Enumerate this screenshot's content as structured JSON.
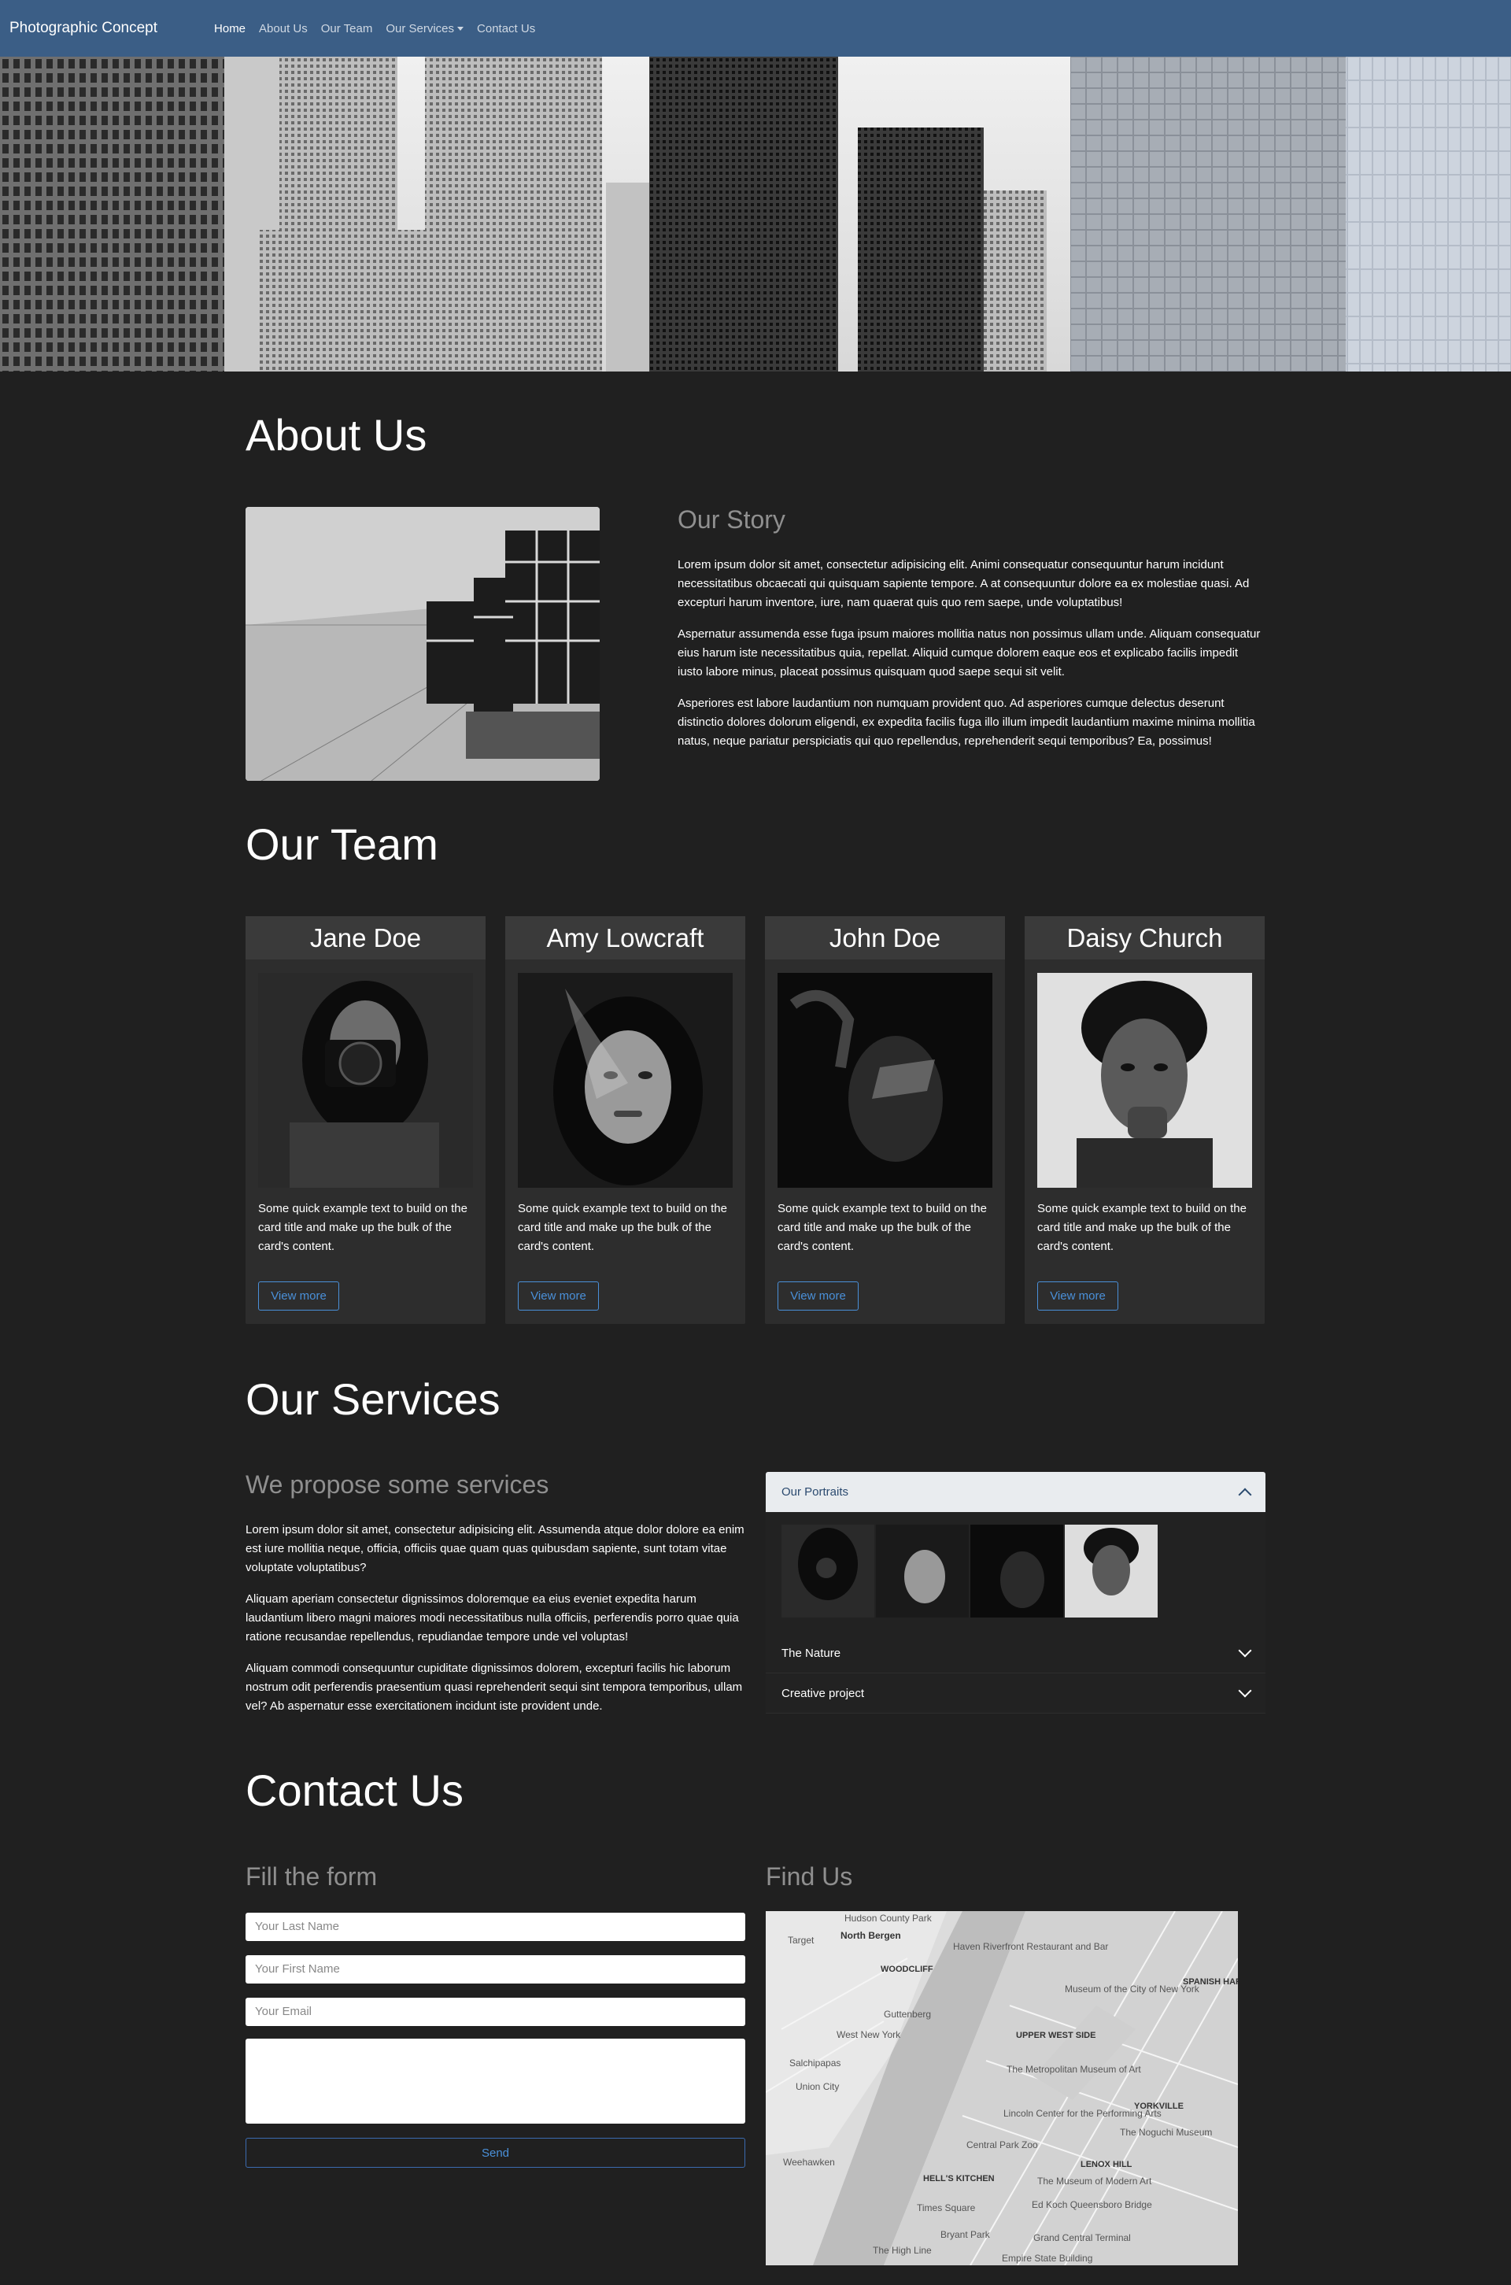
{
  "nav": {
    "brand": "Photographic Concept",
    "links": [
      "Home",
      "About Us",
      "Our Team",
      "Our Services",
      "Contact Us"
    ]
  },
  "about": {
    "title": "About Us",
    "subtitle": "Our Story",
    "paragraphs": [
      "Lorem ipsum dolor sit amet, consectetur adipisicing elit. Animi consequatur consequuntur harum incidunt necessitatibus obcaecati qui quisquam sapiente tempore. A at consequuntur dolore ea ex molestiae quasi. Ad excepturi harum inventore, iure, nam quaerat quis quo rem saepe, unde voluptatibus!",
      "Aspernatur assumenda esse fuga ipsum maiores mollitia natus non possimus ullam unde. Aliquam consequatur eius harum iste necessitatibus quia, repellat. Aliquid cumque dolorem eaque eos et explicabo facilis impedit iusto labore minus, placeat possimus quisquam quod saepe sequi sit velit.",
      "Asperiores est labore laudantium non numquam provident quo. Ad asperiores cumque delectus deserunt distinctio dolores dolorum eligendi, ex expedita facilis fuga illo illum impedit laudantium maxime minima mollitia natus, neque pariatur perspiciatis qui quo repellendus, reprehenderit sequi temporibus? Ea, possimus!"
    ]
  },
  "team": {
    "title": "Our Team",
    "members": [
      {
        "name": "Jane Doe",
        "text": "Some quick example text to build on the card title and make up the bulk of the card's content.",
        "button": "View more"
      },
      {
        "name": "Amy Lowcraft",
        "text": "Some quick example text to build on the card title and make up the bulk of the card's content.",
        "button": "View more"
      },
      {
        "name": "John Doe",
        "text": "Some quick example text to build on the card title and make up the bulk of the card's content.",
        "button": "View more"
      },
      {
        "name": "Daisy Church",
        "text": "Some quick example text to build on the card title and make up the bulk of the card's content.",
        "button": "View more"
      }
    ]
  },
  "services": {
    "title": "Our Services",
    "subtitle": "We propose some services",
    "paragraphs": [
      "Lorem ipsum dolor sit amet, consectetur adipisicing elit. Assumenda atque dolor dolore ea enim est iure mollitia neque, officia, officiis quae quam quas quibusdam sapiente, sunt totam vitae voluptate voluptatibus?",
      "Aliquam aperiam consectetur dignissimos doloremque ea eius eveniet expedita harum laudantium libero magni maiores modi necessitatibus nulla officiis, perferendis porro quae quia ratione recusandae repellendus, repudiandae tempore unde vel voluptas!",
      "Aliquam commodi consequuntur cupiditate dignissimos dolorem, excepturi facilis hic laborum nostrum odit perferendis praesentium quasi reprehenderit sequi sint tempora temporibus, ullam vel? Ab aspernatur esse exercitationem incidunt iste provident unde."
    ],
    "accordion": [
      "Our Portraits",
      "The Nature",
      "Creative project"
    ]
  },
  "contact": {
    "title": "Contact Us",
    "form_title": "Fill the form",
    "map_title": "Find Us",
    "placeholders": {
      "last_name": "Your Last Name",
      "first_name": "Your First Name",
      "email": "Your Email"
    },
    "send": "Send"
  },
  "map": {
    "labels": [
      "Hudson County Park",
      "North Bergen",
      "Target",
      "Haven Riverfront Restaurant and Bar",
      "WOODCLIFF",
      "Museum of the City of New York",
      "SPANISH HARLEM",
      "Guttenberg",
      "West New York",
      "UPPER WEST SIDE",
      "Salchipapas",
      "Union City",
      "The Metropolitan Museum of Art",
      "YORKVILLE",
      "Lincoln Center for the Performing Arts",
      "Central Park Zoo",
      "The Noguchi Museum",
      "Weehawken",
      "LENOX HILL",
      "HELL'S KITCHEN",
      "The Museum of Modern Art",
      "Ed Koch Queensboro Bridge",
      "Times Square",
      "Bryant Park",
      "Grand Central Terminal",
      "The High Line",
      "Empire State Building"
    ]
  }
}
